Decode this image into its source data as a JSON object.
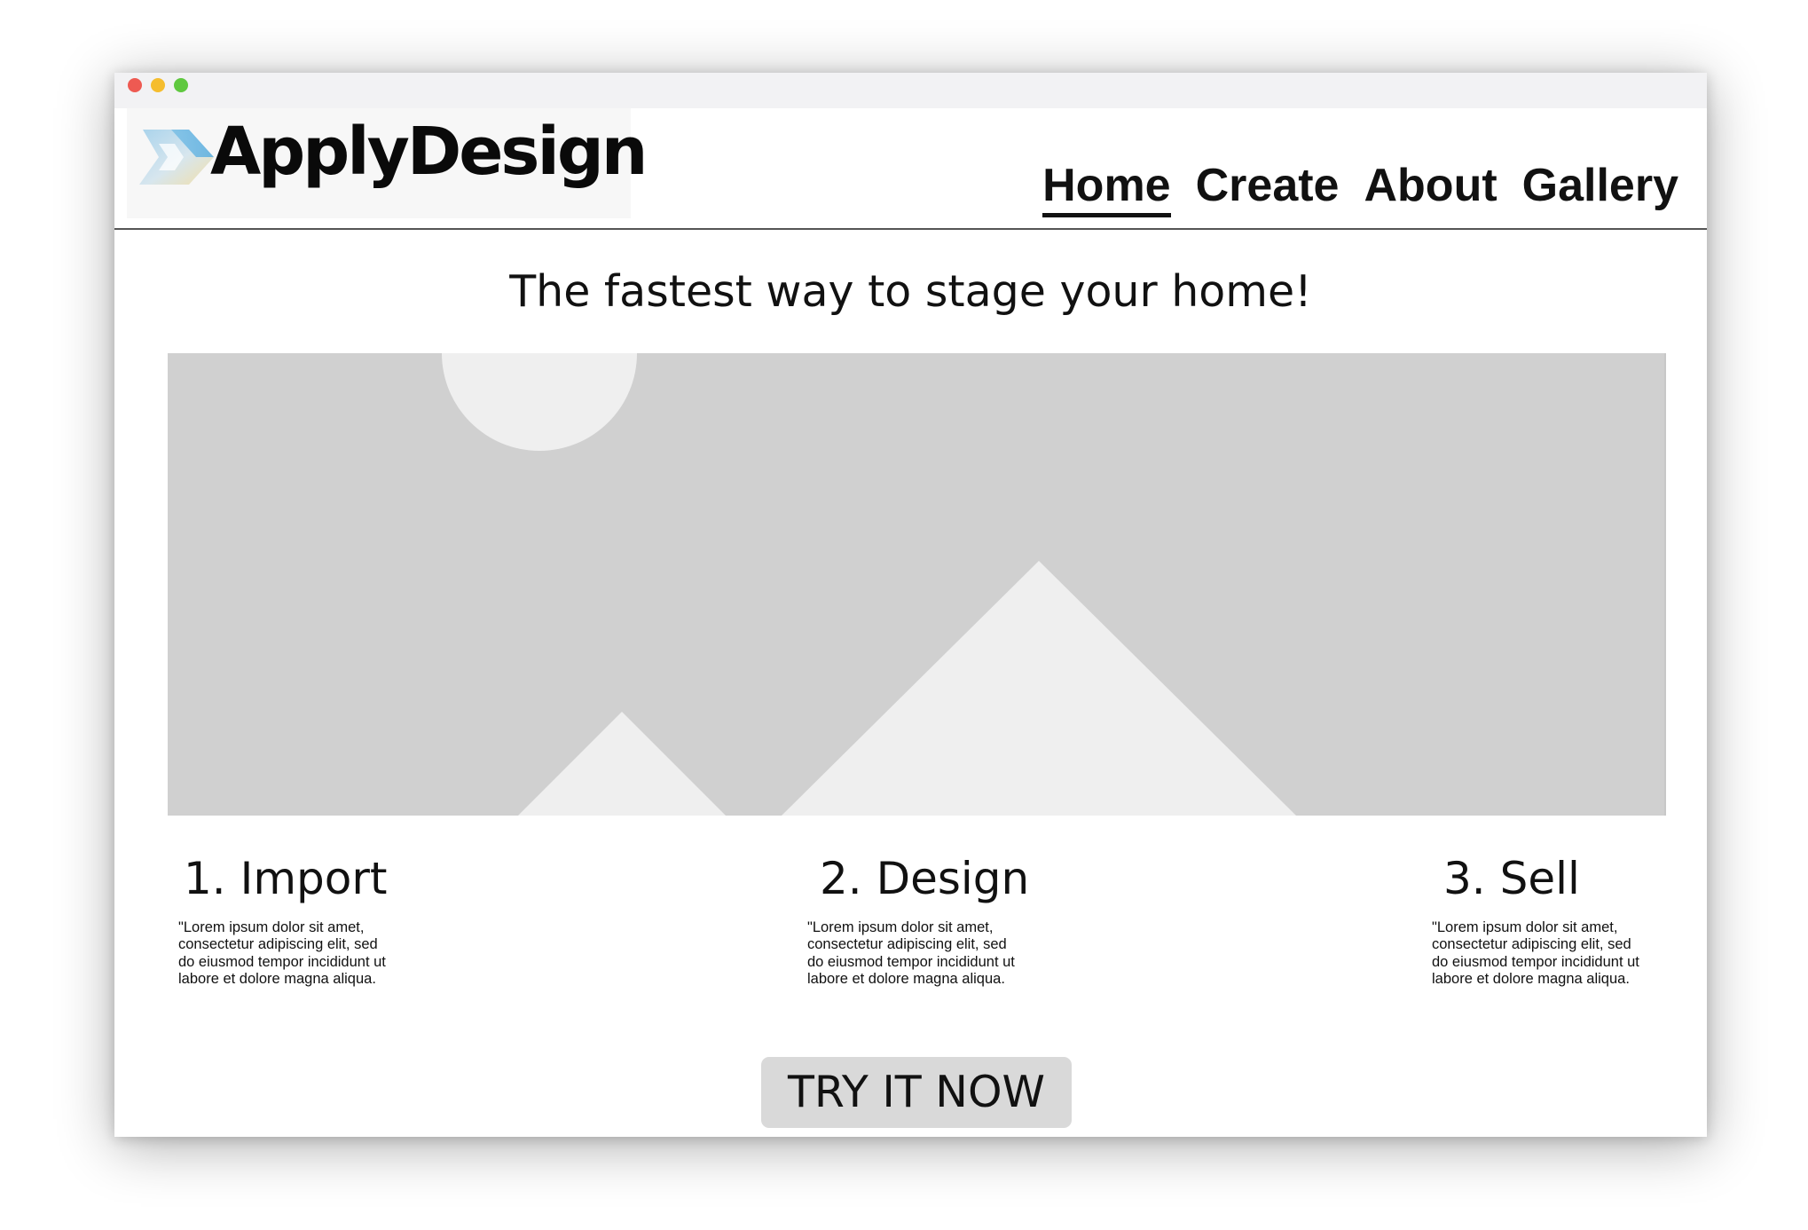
{
  "window": {
    "traffic_lights": {
      "close_color": "#ee5a52",
      "minimize_color": "#f5bd2e",
      "maximize_color": "#5fc83f"
    }
  },
  "header": {
    "logo_text": "ApplyDesign",
    "nav": [
      {
        "label": "Home",
        "active": true
      },
      {
        "label": "Create",
        "active": false
      },
      {
        "label": "About",
        "active": false
      },
      {
        "label": "Gallery",
        "active": false
      }
    ]
  },
  "main": {
    "tagline": "The fastest way to stage your home!",
    "hero_image": {
      "icon": "image-placeholder-icon",
      "background_color": "#d0d0d0",
      "shape_color": "#efefef"
    },
    "steps": [
      {
        "title": "1. Import",
        "description": "\"Lorem ipsum dolor sit amet, consectetur adipiscing elit, sed do eiusmod tempor incididunt ut labore et dolore magna aliqua."
      },
      {
        "title": "2. Design",
        "description": "\"Lorem ipsum dolor sit amet, consectetur adipiscing elit, sed do eiusmod tempor incididunt ut labore et dolore magna aliqua."
      },
      {
        "title": "3. Sell",
        "description": "\"Lorem ipsum dolor sit amet, consectetur adipiscing elit, sed do eiusmod tempor incididunt ut labore et dolore magna aliqua."
      }
    ],
    "cta_label": "TRY IT NOW"
  }
}
